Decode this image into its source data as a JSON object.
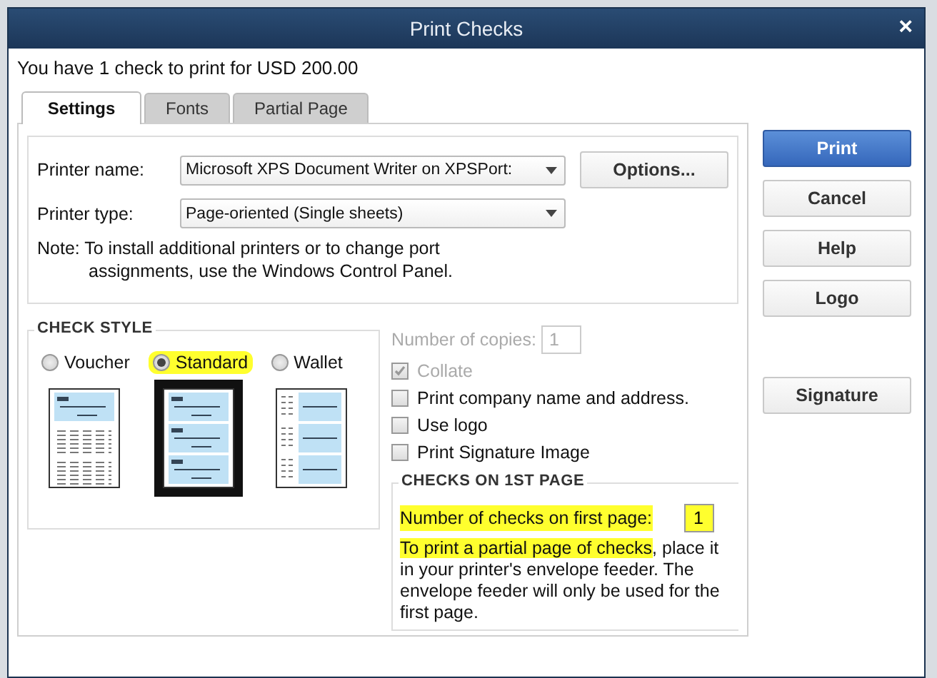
{
  "window": {
    "title": "Print Checks",
    "close": "×"
  },
  "summary": "You have 1 check to print for USD 200.00",
  "tabs": [
    {
      "label": "Settings",
      "selected": true
    },
    {
      "label": "Fonts",
      "selected": false
    },
    {
      "label": "Partial Page",
      "selected": false
    }
  ],
  "printer": {
    "name_label": "Printer name:",
    "name_value": "Microsoft XPS Document Writer on XPSPort:",
    "type_label": "Printer type:",
    "type_value": "Page-oriented (Single sheets)",
    "options_button": "Options...",
    "note_line_1": "Note: To install additional printers or to change port",
    "note_line_2": "assignments, use the Windows Control Panel."
  },
  "check_style": {
    "title": "CHECK STYLE",
    "options": [
      {
        "kind": "voucher",
        "label": "Voucher",
        "selected": false,
        "highlighted": false
      },
      {
        "kind": "standard",
        "label": "Standard",
        "selected": true,
        "highlighted": true
      },
      {
        "kind": "wallet",
        "label": "Wallet",
        "selected": false,
        "highlighted": false
      }
    ]
  },
  "copies": {
    "label": "Number of copies:",
    "value": "1",
    "disabled": true
  },
  "checkboxes": [
    {
      "label": "Collate",
      "checked": true,
      "disabled": true
    },
    {
      "label": "Print company name and address.",
      "checked": false,
      "disabled": false
    },
    {
      "label": "Use logo",
      "checked": false,
      "disabled": false
    },
    {
      "label": "Print Signature Image",
      "checked": false,
      "disabled": false
    }
  ],
  "first_page": {
    "title": "CHECKS ON 1ST PAGE",
    "count_label": "Number of checks on first page:",
    "count_label_highlighted": true,
    "count_value": "1",
    "count_value_highlighted": true,
    "note_highlighted_part": "To print a partial page of checks",
    "note_rest": ", place it in your printer's envelope feeder.  The envelope feeder will only be used for the first page."
  },
  "buttons": [
    {
      "kind": "primary",
      "label": "Print"
    },
    {
      "kind": "normal",
      "label": "Cancel"
    },
    {
      "kind": "normal",
      "label": "Help"
    },
    {
      "kind": "normal",
      "label": "Logo"
    },
    {
      "kind": "spacer-normal",
      "label": "Signature"
    }
  ]
}
